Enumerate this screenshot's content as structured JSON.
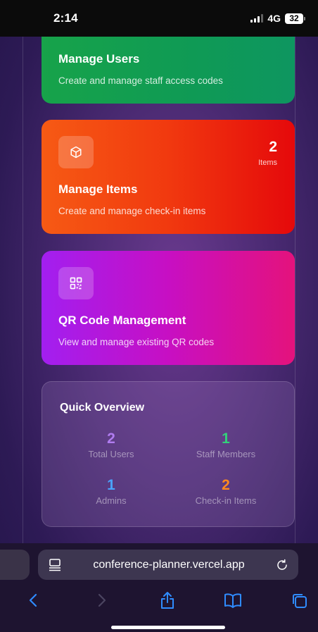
{
  "status_bar": {
    "time": "2:14",
    "network": "4G",
    "battery": "32"
  },
  "cards": {
    "users": {
      "title": "Manage Users",
      "description": "Create and manage staff access codes",
      "color": "#16a34a"
    },
    "items": {
      "title": "Manage Items",
      "description": "Create and manage check-in items",
      "stat_value": "2",
      "stat_label": "Items",
      "icon": "box-icon",
      "color": "#f2400f"
    },
    "qr": {
      "title": "QR Code Management",
      "description": "View and manage existing QR codes",
      "icon": "qr-code-icon",
      "color": "#c514c8"
    }
  },
  "overview": {
    "title": "Quick Overview",
    "stats": [
      {
        "value": "2",
        "label": "Total Users",
        "color": "#b07cf0"
      },
      {
        "value": "1",
        "label": "Staff Members",
        "color": "#33d17a"
      },
      {
        "value": "1",
        "label": "Admins",
        "color": "#4aa3ff"
      },
      {
        "value": "2",
        "label": "Check-in Items",
        "color": "#ff8a1f"
      }
    ]
  },
  "browser": {
    "url": "conference-planner.vercel.app",
    "toolbar_icons": [
      "back-icon",
      "forward-icon",
      "share-icon",
      "bookmarks-icon",
      "tabs-icon"
    ]
  }
}
